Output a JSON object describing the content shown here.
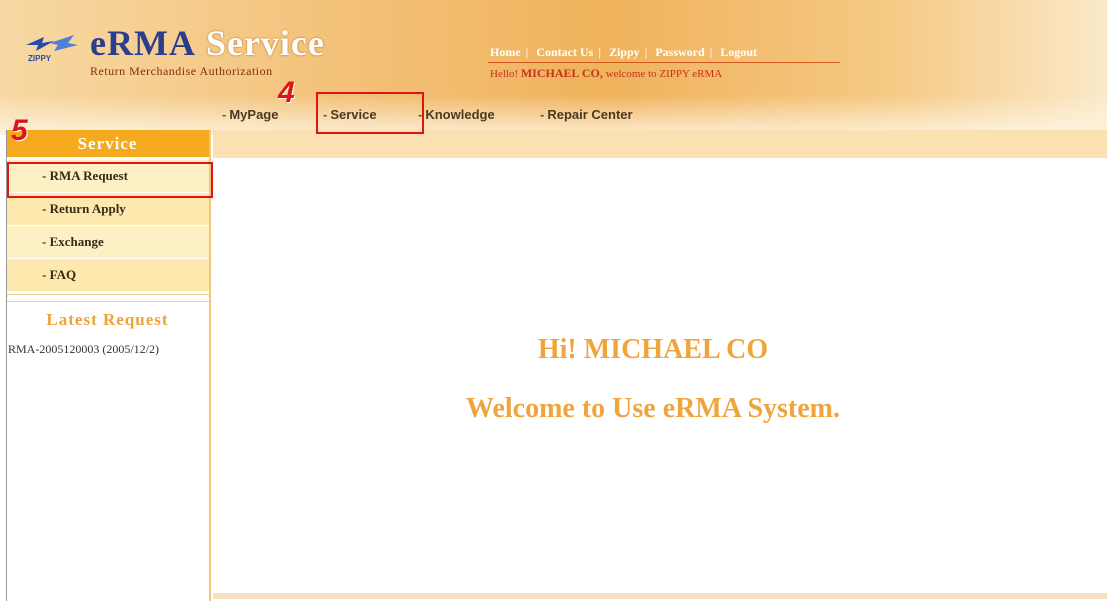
{
  "header": {
    "logo_title": "eRMA",
    "logo_title_service": "Service",
    "logo_subtitle": "Return Merchandise Authorization",
    "logo_badge": "ZIPPY",
    "links": [
      "Home",
      "Contact Us",
      "Zippy",
      "Password",
      "Logout"
    ],
    "greeting_prefix": "Hello!",
    "greeting_name": "MICHAEL CO,",
    "greeting_suffix": "welcome to ZIPPY eRMA"
  },
  "nav": {
    "items": [
      "MyPage",
      "Service",
      "Knowledge",
      "Repair Center"
    ]
  },
  "annotations": {
    "step4": "4",
    "step5": "5"
  },
  "sidebar": {
    "title": "Service",
    "items": [
      "RMA Request",
      "Return Apply",
      "Exchange",
      "FAQ"
    ],
    "latest_title": "Latest Request",
    "latest_item": "RMA-2005120003 (2005/12/2)"
  },
  "main": {
    "hi": "Hi! MICHAEL CO",
    "welcome": "Welcome to Use eRMA System."
  },
  "colors": {
    "accent": "#f5a91e",
    "annotation": "#e01414",
    "welcome_text": "#efa53d"
  }
}
